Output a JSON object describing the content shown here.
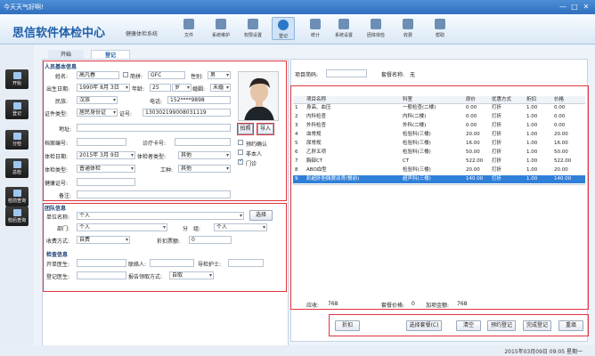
{
  "window": {
    "title": "今天天气好啊!",
    "controls": [
      "—",
      "□",
      "✕"
    ]
  },
  "app": {
    "title": "思信软件体检中心",
    "subtitle": "健康体检系统"
  },
  "toolbar": [
    {
      "label": "文件",
      "icon": "file-icon"
    },
    {
      "label": "系统维护",
      "icon": "maintenance-icon"
    },
    {
      "label": "权限设置",
      "icon": "permission-icon"
    },
    {
      "label": "登记",
      "icon": "register-icon",
      "active": true
    },
    {
      "label": "统计",
      "icon": "statistics-icon"
    },
    {
      "label": "系统设置",
      "icon": "settings-icon"
    },
    {
      "label": "团体体检",
      "icon": "group-checkup-icon"
    },
    {
      "label": "收费",
      "icon": "charge-icon"
    },
    {
      "label": "帮助",
      "icon": "help-icon"
    }
  ],
  "sidebar": [
    "开始",
    "登记",
    "分检",
    "总检",
    "检前查询",
    "检后查询"
  ],
  "tabs": [
    "开始",
    "登记"
  ],
  "personal": {
    "section": "人员基本信息",
    "name_label": "姓名:",
    "name": "高凡春",
    "pinyin_label": "简拼:",
    "pinyin": "GFC",
    "gender_label": "性别:",
    "gender": "男",
    "birth_label": "出生日期:",
    "birth": "1990年 8月 3日",
    "age_label": "年龄:",
    "age": "25",
    "age_unit": "岁",
    "marital_label": "婚姻:",
    "marital": "未婚",
    "ethnic_label": "民族:",
    "ethnic": "汉族",
    "phone_label": "电话:",
    "phone": "152****9898",
    "idtype_label": "证件类型:",
    "idtype": "居民身份证",
    "idno_label": "证号:",
    "idno": "130302199008031119",
    "address_label": "地址:",
    "file_label": "档案编号:",
    "card_label": "诊疗卡号:",
    "exam_date_label": "体检日期:",
    "exam_date": "2015年 3月 9日",
    "exam_kind_label": "体检者类型:",
    "exam_kind": "其他",
    "exam_type_label": "体检类型:",
    "exam_type": "普通体检",
    "job_label": "工种:",
    "job": "其他",
    "health_label": "健康证号:",
    "note_label": "备注:",
    "photo_btn": "拍照",
    "import_btn": "导入",
    "chk_appointment": "预约确认",
    "chk_self": "非本人",
    "chk_outpatient": "门诊"
  },
  "team": {
    "section": "团队信息",
    "unit_label": "单位名称:",
    "unit": "个人",
    "select_btn": "选择",
    "dept_label": "部门:",
    "dept": "个人",
    "subgroup_label": "分　组:",
    "subgroup": "个人",
    "pay_label": "收费方式:",
    "pay": "自费",
    "discount_label": "折扣票额:",
    "discount": "0"
  },
  "checkinfo": {
    "section": "检查信息",
    "doctor_label": "开单医生:",
    "contact_label": "联络人:",
    "nurse_label": "导检护士:",
    "reg_doctor_label": "登记医生:",
    "report_label": "报告领取方式:",
    "report": "自取"
  },
  "right": {
    "code_label": "项目简码:",
    "package_label": "套餐名称:",
    "package": "无",
    "columns": [
      "项目名称",
      "科室",
      "原价",
      "优惠方式",
      "折扣",
      "价格"
    ],
    "rows": [
      [
        "身高、血压",
        "一般检查(二楼)",
        "0.00",
        "打折",
        "1.00",
        "0.00"
      ],
      [
        "内科检查",
        "内科(二楼)",
        "0.00",
        "打折",
        "1.00",
        "0.00"
      ],
      [
        "外科检查",
        "外科(二楼)",
        "0.00",
        "打折",
        "1.00",
        "0.00"
      ],
      [
        "血常规",
        "检验科(三楼)",
        "20.00",
        "打折",
        "1.00",
        "20.00"
      ],
      [
        "尿常规",
        "检验科(三楼)",
        "16.00",
        "打折",
        "1.00",
        "16.00"
      ],
      [
        "乙肝五项",
        "检验科(三楼)",
        "50.00",
        "打折",
        "1.00",
        "50.00"
      ],
      [
        "胸部CT",
        "CT",
        "522.00",
        "打折",
        "1.00",
        "522.00"
      ],
      [
        "ABO血型",
        "检验科(三楼)",
        "20.00",
        "打折",
        "1.00",
        "20.00"
      ],
      [
        "彩超肝胆胰脾双肾(餐前)",
        "超声科(三楼)",
        "140.00",
        "打折",
        "1.00",
        "140.00"
      ]
    ],
    "row_numbers": [
      "1",
      "2",
      "3",
      "4",
      "5",
      "6",
      "7",
      "8",
      "9"
    ],
    "should_label": "应收:",
    "should": "768",
    "pkg_price_label": "套餐价格:",
    "pkg_price": "0",
    "add_amount_label": "加项金额:",
    "add_amount": "768",
    "buttons": [
      "折扣",
      "选择套餐(C)",
      "清空",
      "预约登记",
      "完成登记",
      "重填"
    ]
  },
  "status": {
    "datetime": "2015年03月09日 09:05 星期一"
  }
}
